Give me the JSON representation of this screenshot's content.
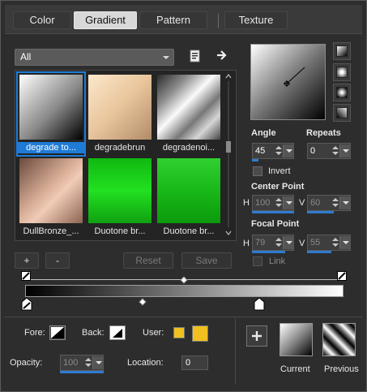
{
  "tabs": [
    {
      "label": "Color"
    },
    {
      "label": "Gradient"
    },
    {
      "label": "Pattern"
    },
    {
      "label": "Texture"
    }
  ],
  "category_dropdown": {
    "value": "All"
  },
  "gallery": {
    "items": [
      {
        "name": "degrade to...",
        "selected": true
      },
      {
        "name": "degradebrun",
        "selected": false
      },
      {
        "name": "degradenoi...",
        "selected": false
      },
      {
        "name": "DullBronze_...",
        "selected": false
      },
      {
        "name": "Duotone br...",
        "selected": false
      },
      {
        "name": "Duotone br...",
        "selected": false
      }
    ]
  },
  "buttons": {
    "add": "+",
    "remove": "-",
    "reset": "Reset",
    "save": "Save"
  },
  "angle": {
    "label": "Angle",
    "value": "45"
  },
  "repeats": {
    "label": "Repeats",
    "value": "0"
  },
  "invert": {
    "label": "Invert",
    "checked": false
  },
  "center_point": {
    "label": "Center Point",
    "h_label": "H",
    "h_value": "100",
    "v_label": "V",
    "v_value": "60"
  },
  "focal_point": {
    "label": "Focal Point",
    "h_label": "H",
    "h_value": "79",
    "v_label": "V",
    "v_value": "55"
  },
  "link": {
    "label": "Link",
    "checked": false
  },
  "materials": {
    "fore_label": "Fore:",
    "back_label": "Back:",
    "user_label": "User:",
    "user_colors": [
      "#f0c020",
      "#f0c020"
    ]
  },
  "opacity": {
    "label": "Opacity:",
    "value": "100"
  },
  "location": {
    "label": "Location:",
    "value": "0"
  },
  "current": {
    "label": "Current"
  },
  "previous": {
    "label": "Previous"
  },
  "colors": {
    "accent": "#1f7bd6"
  }
}
